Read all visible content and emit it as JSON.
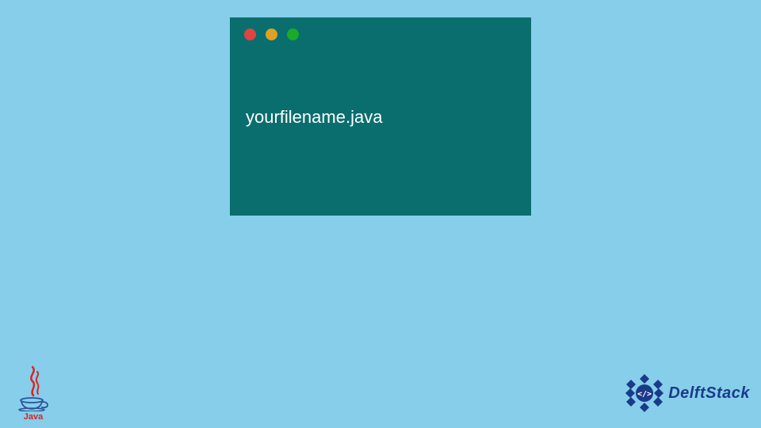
{
  "window": {
    "content": "yourfilename.java",
    "dots": {
      "red": "#e0443e",
      "yellow": "#dea123",
      "green": "#1aab29"
    }
  },
  "logos": {
    "java_label": "Java",
    "delft_label": "DelftStack"
  }
}
